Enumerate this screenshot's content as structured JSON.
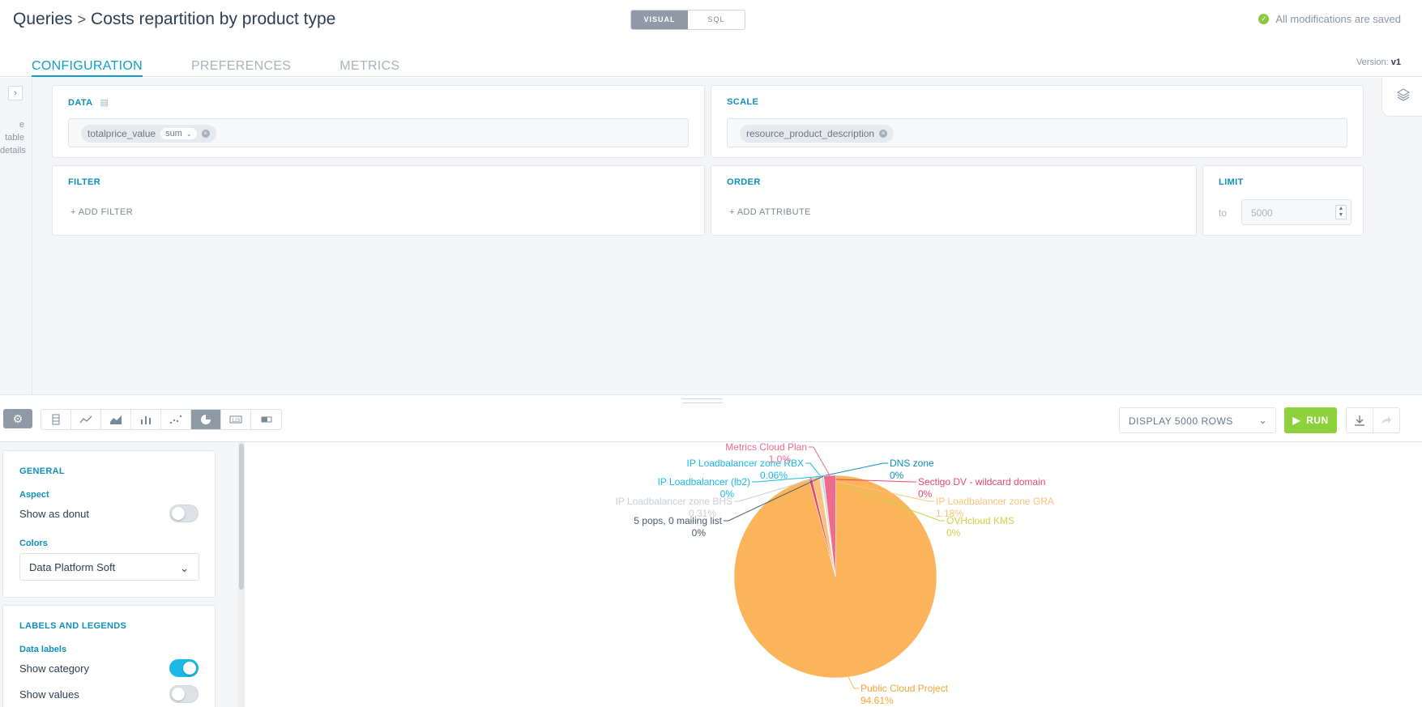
{
  "breadcrumb": {
    "root": "Queries",
    "separator": ">",
    "title": "Costs repartition by product type"
  },
  "mode": {
    "visual": "VISUAL",
    "sql": "SQL"
  },
  "status": {
    "saved": "All modifications are saved"
  },
  "tabs": [
    {
      "label": "CONFIGURATION"
    },
    {
      "label": "PREFERENCES"
    },
    {
      "label": "METRICS"
    }
  ],
  "version": {
    "label": "Version:",
    "value": "v1"
  },
  "leftrail": {
    "line1": "e table",
    "line2": "details"
  },
  "config": {
    "data": {
      "title": "DATA",
      "field": "totalprice_value",
      "aggregation": "sum"
    },
    "scale": {
      "title": "SCALE",
      "field": "resource_product_description"
    },
    "filter": {
      "title": "FILTER",
      "add_label": "ADD FILTER"
    },
    "order": {
      "title": "ORDER",
      "add_label": "ADD ATTRIBUTE"
    },
    "limit": {
      "title": "LIMIT",
      "to_label": "to",
      "value": "5000"
    }
  },
  "toolbar": {
    "display_rows": "DISPLAY 5000 ROWS",
    "run_label": "RUN"
  },
  "panel": {
    "general": {
      "title": "GENERAL",
      "aspect_title": "Aspect",
      "donut_label": "Show as donut",
      "donut_on": false,
      "colors_title": "Colors",
      "colors_value": "Data Platform Soft"
    },
    "labels": {
      "title": "LABELS AND LEGENDS",
      "data_labels_title": "Data labels",
      "show_category_label": "Show category",
      "show_category_on": true,
      "show_values_label": "Show values",
      "show_values_on": false
    }
  },
  "colors": {
    "accent": "#0e9fc8",
    "run": "#8dd13c",
    "toggle_on": "#19b8e6"
  },
  "chart_data": {
    "type": "pie",
    "title": "",
    "slices": [
      {
        "label": "Public Cloud Project",
        "value": 94.61,
        "pct": "94.61%",
        "color": "#fbb45a"
      },
      {
        "label": "Sectigo DV - wildcard domain",
        "value": 0.5,
        "pct": "0%",
        "color": "#e8476e"
      },
      {
        "label": "IP Loadbalancer zone GRA",
        "value": 1.18,
        "pct": "1.18%",
        "color": "#f9c27a"
      },
      {
        "label": "OVHcloud KMS",
        "value": 0.1,
        "pct": "0%",
        "color": "#c8d545"
      },
      {
        "label": "DNS zone",
        "value": 0.1,
        "pct": "0%",
        "color": "#0e8fb8"
      },
      {
        "label": "IP Loadbalancer zone RBX",
        "value": 0.06,
        "pct": "0.06%",
        "color": "#19b8e6"
      },
      {
        "label": "IP Loadbalancer (lb2)",
        "value": 0.05,
        "pct": "0%",
        "color": "#19b8e6"
      },
      {
        "label": "IP Loadbalancer zone BHS",
        "value": 0.31,
        "pct": "0.31%",
        "color": "#c9ced5"
      },
      {
        "label": "5 pops, 0 mailing list",
        "value": 0.05,
        "pct": "0%",
        "color": "#4a5a6c"
      },
      {
        "label": "Metrics Cloud Plan",
        "value": 1.9,
        "pct": "1.0%",
        "color": "#f06a8c"
      }
    ],
    "legend": "none"
  }
}
